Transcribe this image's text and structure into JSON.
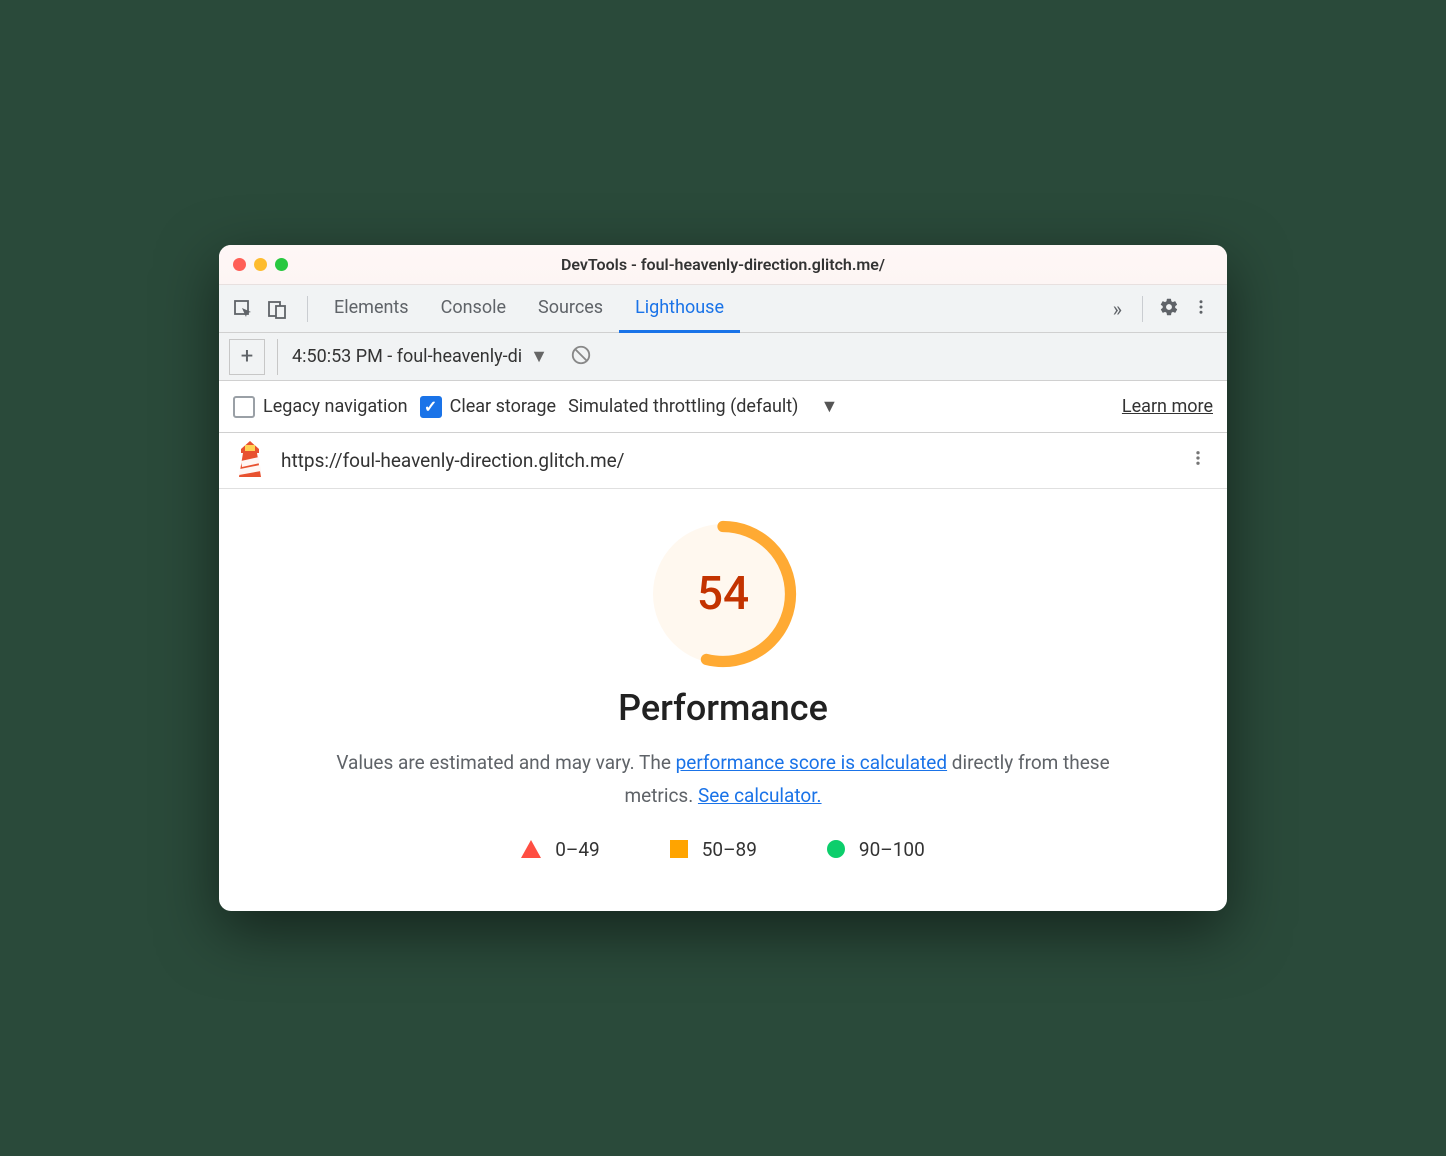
{
  "window": {
    "title": "DevTools - foul-heavenly-direction.glitch.me/"
  },
  "tabs": {
    "items": [
      "Elements",
      "Console",
      "Sources",
      "Lighthouse"
    ],
    "active": "Lighthouse"
  },
  "sub": {
    "report_label": "4:50:53 PM - foul-heavenly-di"
  },
  "options": {
    "legacy_label": "Legacy navigation",
    "clear_label": "Clear storage",
    "throttling_label": "Simulated throttling (default)",
    "learn_more": "Learn more"
  },
  "url_row": {
    "url": "https://foul-heavenly-direction.glitch.me/"
  },
  "report": {
    "score": "54",
    "category": "Performance",
    "desc_prefix": "Values are estimated and may vary. The ",
    "desc_link1": "performance score is calculated",
    "desc_mid": " directly from these metrics. ",
    "desc_link2": "See calculator.",
    "legend": {
      "fail": "0–49",
      "avg": "50–89",
      "pass": "90–100"
    }
  },
  "colors": {
    "fail": "#ff4e42",
    "avg": "#ffa400",
    "pass": "#0cce6b",
    "link": "#1a73e8"
  }
}
